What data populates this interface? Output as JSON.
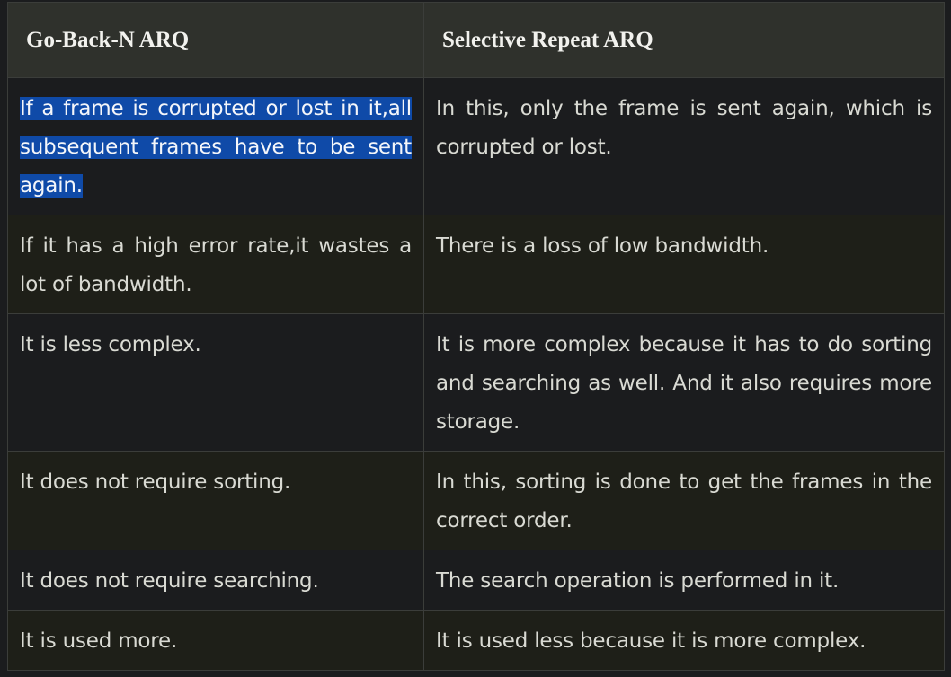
{
  "table": {
    "headers": [
      "Go-Back-N ARQ",
      "Selective Repeat ARQ"
    ],
    "rows": [
      {
        "col1": "If a frame is corrupted or lost in it,all subsequent frames have to be sent again.",
        "col2": "In this, only the frame is sent again, which is corrupted or lost.",
        "col1_selected": true
      },
      {
        "col1": "If it has a high error rate,it wastes a lot of bandwidth.",
        "col2": "There is a loss of low bandwidth."
      },
      {
        "col1": "It is less complex.",
        "col2": "It is more complex because it has to do sorting and searching as well. And it also requires more storage."
      },
      {
        "col1": "It does not require sorting.",
        "col2": "In this, sorting is done to get the frames in the correct order."
      },
      {
        "col1": "It does not require searching.",
        "col2": "The search operation is performed in it."
      },
      {
        "col1": "It is used more.",
        "col2": "It is used less because it is more complex."
      }
    ]
  },
  "colors": {
    "page_background": "#1b1c1e",
    "header_background": "#2f312c",
    "row_background_odd": "#1b1c1e",
    "row_background_even": "#1e1f18",
    "selection_highlight": "#0f4aa8",
    "text": "#d9dad3"
  }
}
